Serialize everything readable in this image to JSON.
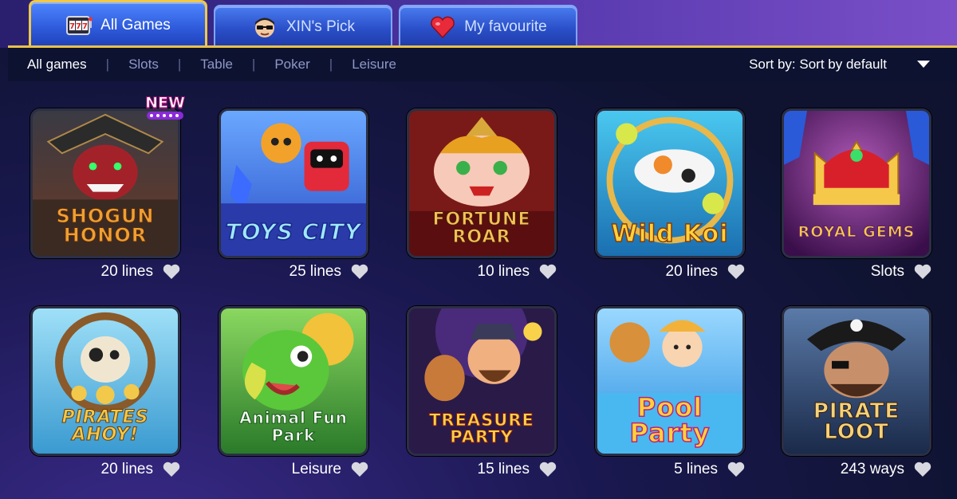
{
  "tabs": [
    {
      "label": "All Games",
      "icon": "slot-777-icon",
      "active": true
    },
    {
      "label": "XIN's Pick",
      "icon": "xin-avatar-icon",
      "active": false
    },
    {
      "label": "My favourite",
      "icon": "heart-icon",
      "active": false
    }
  ],
  "filters": [
    "All games",
    "Slots",
    "Table",
    "Poker",
    "Leisure"
  ],
  "sort": {
    "label": "Sort by: Sort by default"
  },
  "badge": {
    "new": "NEW"
  },
  "games": [
    {
      "title": "SHOGUN HONOR",
      "lines": "20 lines",
      "colors": {
        "bg": "#6b3a24",
        "accent": "#f0a030"
      }
    },
    {
      "title": "TOYS CITY",
      "lines": "25 lines",
      "colors": {
        "bg": "#3a6bd8",
        "accent": "#5fd0ff"
      }
    },
    {
      "title": "FORTUNE ROAR",
      "lines": "10 lines",
      "colors": {
        "bg": "#7a1a18",
        "accent": "#f2c256"
      }
    },
    {
      "title": "Wild Koi",
      "lines": "20 lines",
      "colors": {
        "bg": "#1a7fbf",
        "accent": "#ffd23a"
      }
    },
    {
      "title": "ROYAL GEMS",
      "lines": "Slots",
      "colors": {
        "bg": "#5a1a6a",
        "accent": "#f5c84a"
      }
    },
    {
      "title": "PIRATES AHOY!",
      "lines": "20 lines",
      "colors": {
        "bg": "#5fb8d8",
        "accent": "#f2c94a"
      }
    },
    {
      "title": "Animal Fun Park",
      "lines": "Leisure",
      "colors": {
        "bg": "#3a8a2a",
        "accent": "#ffffff"
      }
    },
    {
      "title": "TREASURE PARTY",
      "lines": "15 lines",
      "colors": {
        "bg": "#2a1a48",
        "accent": "#f7d24a"
      }
    },
    {
      "title": "Pool Party",
      "lines": "5 lines",
      "colors": {
        "bg": "#3ab0f0",
        "accent": "#ffd23a"
      }
    },
    {
      "title": "PIRATE LOOT",
      "lines": "243 ways",
      "colors": {
        "bg": "#2a3a5a",
        "accent": "#f3d27a"
      }
    }
  ]
}
